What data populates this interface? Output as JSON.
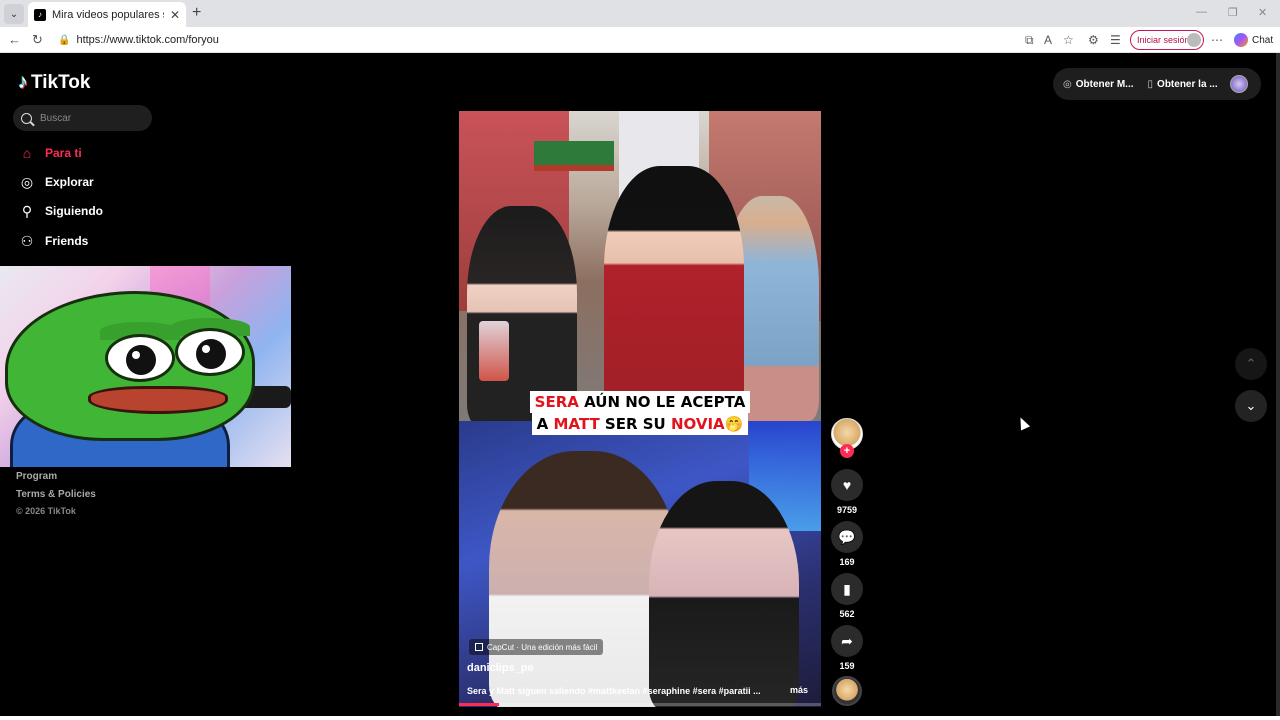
{
  "browser": {
    "tab_title": "Mira videos populares seleccionados",
    "url": "https://www.tiktok.com/foryou",
    "signin_label": "Iniciar sesión",
    "chat_label": "Chat"
  },
  "tiktok": {
    "brand": "TikTok",
    "search_placeholder": "Buscar",
    "nav": [
      {
        "label": "Para ti",
        "icon": "home-icon"
      },
      {
        "label": "Explorar",
        "icon": "compass-icon"
      },
      {
        "label": "Siguiendo",
        "icon": "following-icon"
      },
      {
        "label": "Friends",
        "icon": "friends-icon"
      }
    ],
    "footer": {
      "program": "Program",
      "terms": "Terms & Policies",
      "copyright": "© 2026 TikTok"
    },
    "topbar": {
      "get_coins": "Obtener M...",
      "get_app": "Obtener la ..."
    }
  },
  "video": {
    "caption_line1_red": "SERA",
    "caption_line1_rest": " AÚN NO LE ACEPTA",
    "caption_line2_a": "A ",
    "caption_line2_red1": "MATT",
    "caption_line2_b": " SER SU ",
    "caption_line2_red2": "NOVIA",
    "caption_emoji": "🤭",
    "capcut_label": "CapCut · Una edición más fácil",
    "author": "daniclips_pe",
    "description": "Sera y Matt siguen saliendo #mattkeelan #seraphine #sera #paratii ...",
    "more": "más",
    "progress": 0.11
  },
  "actions": {
    "likes": "9759",
    "comments": "169",
    "saves": "562",
    "shares": "159"
  },
  "colors": {
    "accent": "#fe2c55",
    "background": "#000000"
  }
}
